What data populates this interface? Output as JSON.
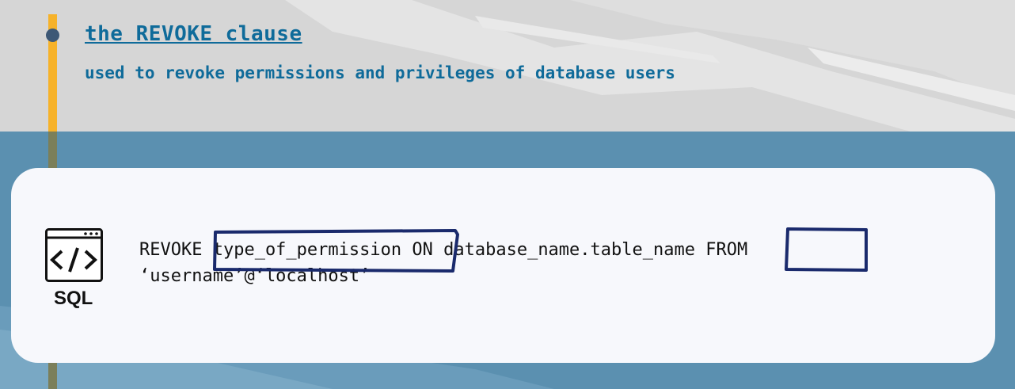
{
  "heading": {
    "title": "the REVOKE clause",
    "subtitle": "used to revoke permissions and privileges of database users"
  },
  "card": {
    "icon": "code-window-icon",
    "icon_label": "SQL",
    "code_line_1": "REVOKE type_of_permission ON database_name.table_name FROM",
    "code_line_2": "‘username’@‘localhost’"
  },
  "colors": {
    "title": "#0f6b9a",
    "accent_line": "#f6b22a",
    "highlight_box": "#1a2a6c",
    "top_background": "#d6d6d6",
    "bottom_background": "#5b90b0"
  }
}
